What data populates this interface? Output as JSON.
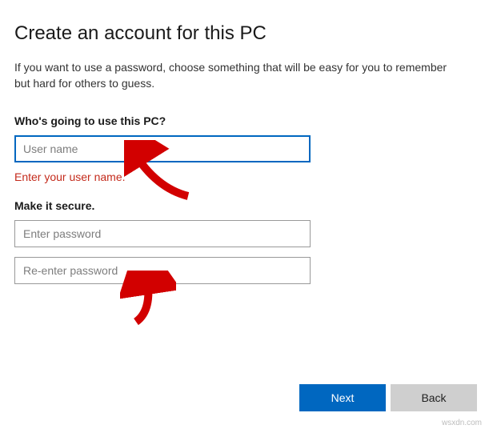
{
  "title": "Create an account for this PC",
  "subtitle": "If you want to use a password, choose something that will be easy for you to remember but hard for others to guess.",
  "section_user": {
    "label": "Who's going to use this PC?",
    "username_placeholder": "User name",
    "error": "Enter your user name."
  },
  "section_secure": {
    "label": "Make it secure.",
    "password_placeholder": "Enter password",
    "reenter_placeholder": "Re-enter password"
  },
  "buttons": {
    "next": "Next",
    "back": "Back"
  },
  "watermark": "wsxdn.com"
}
